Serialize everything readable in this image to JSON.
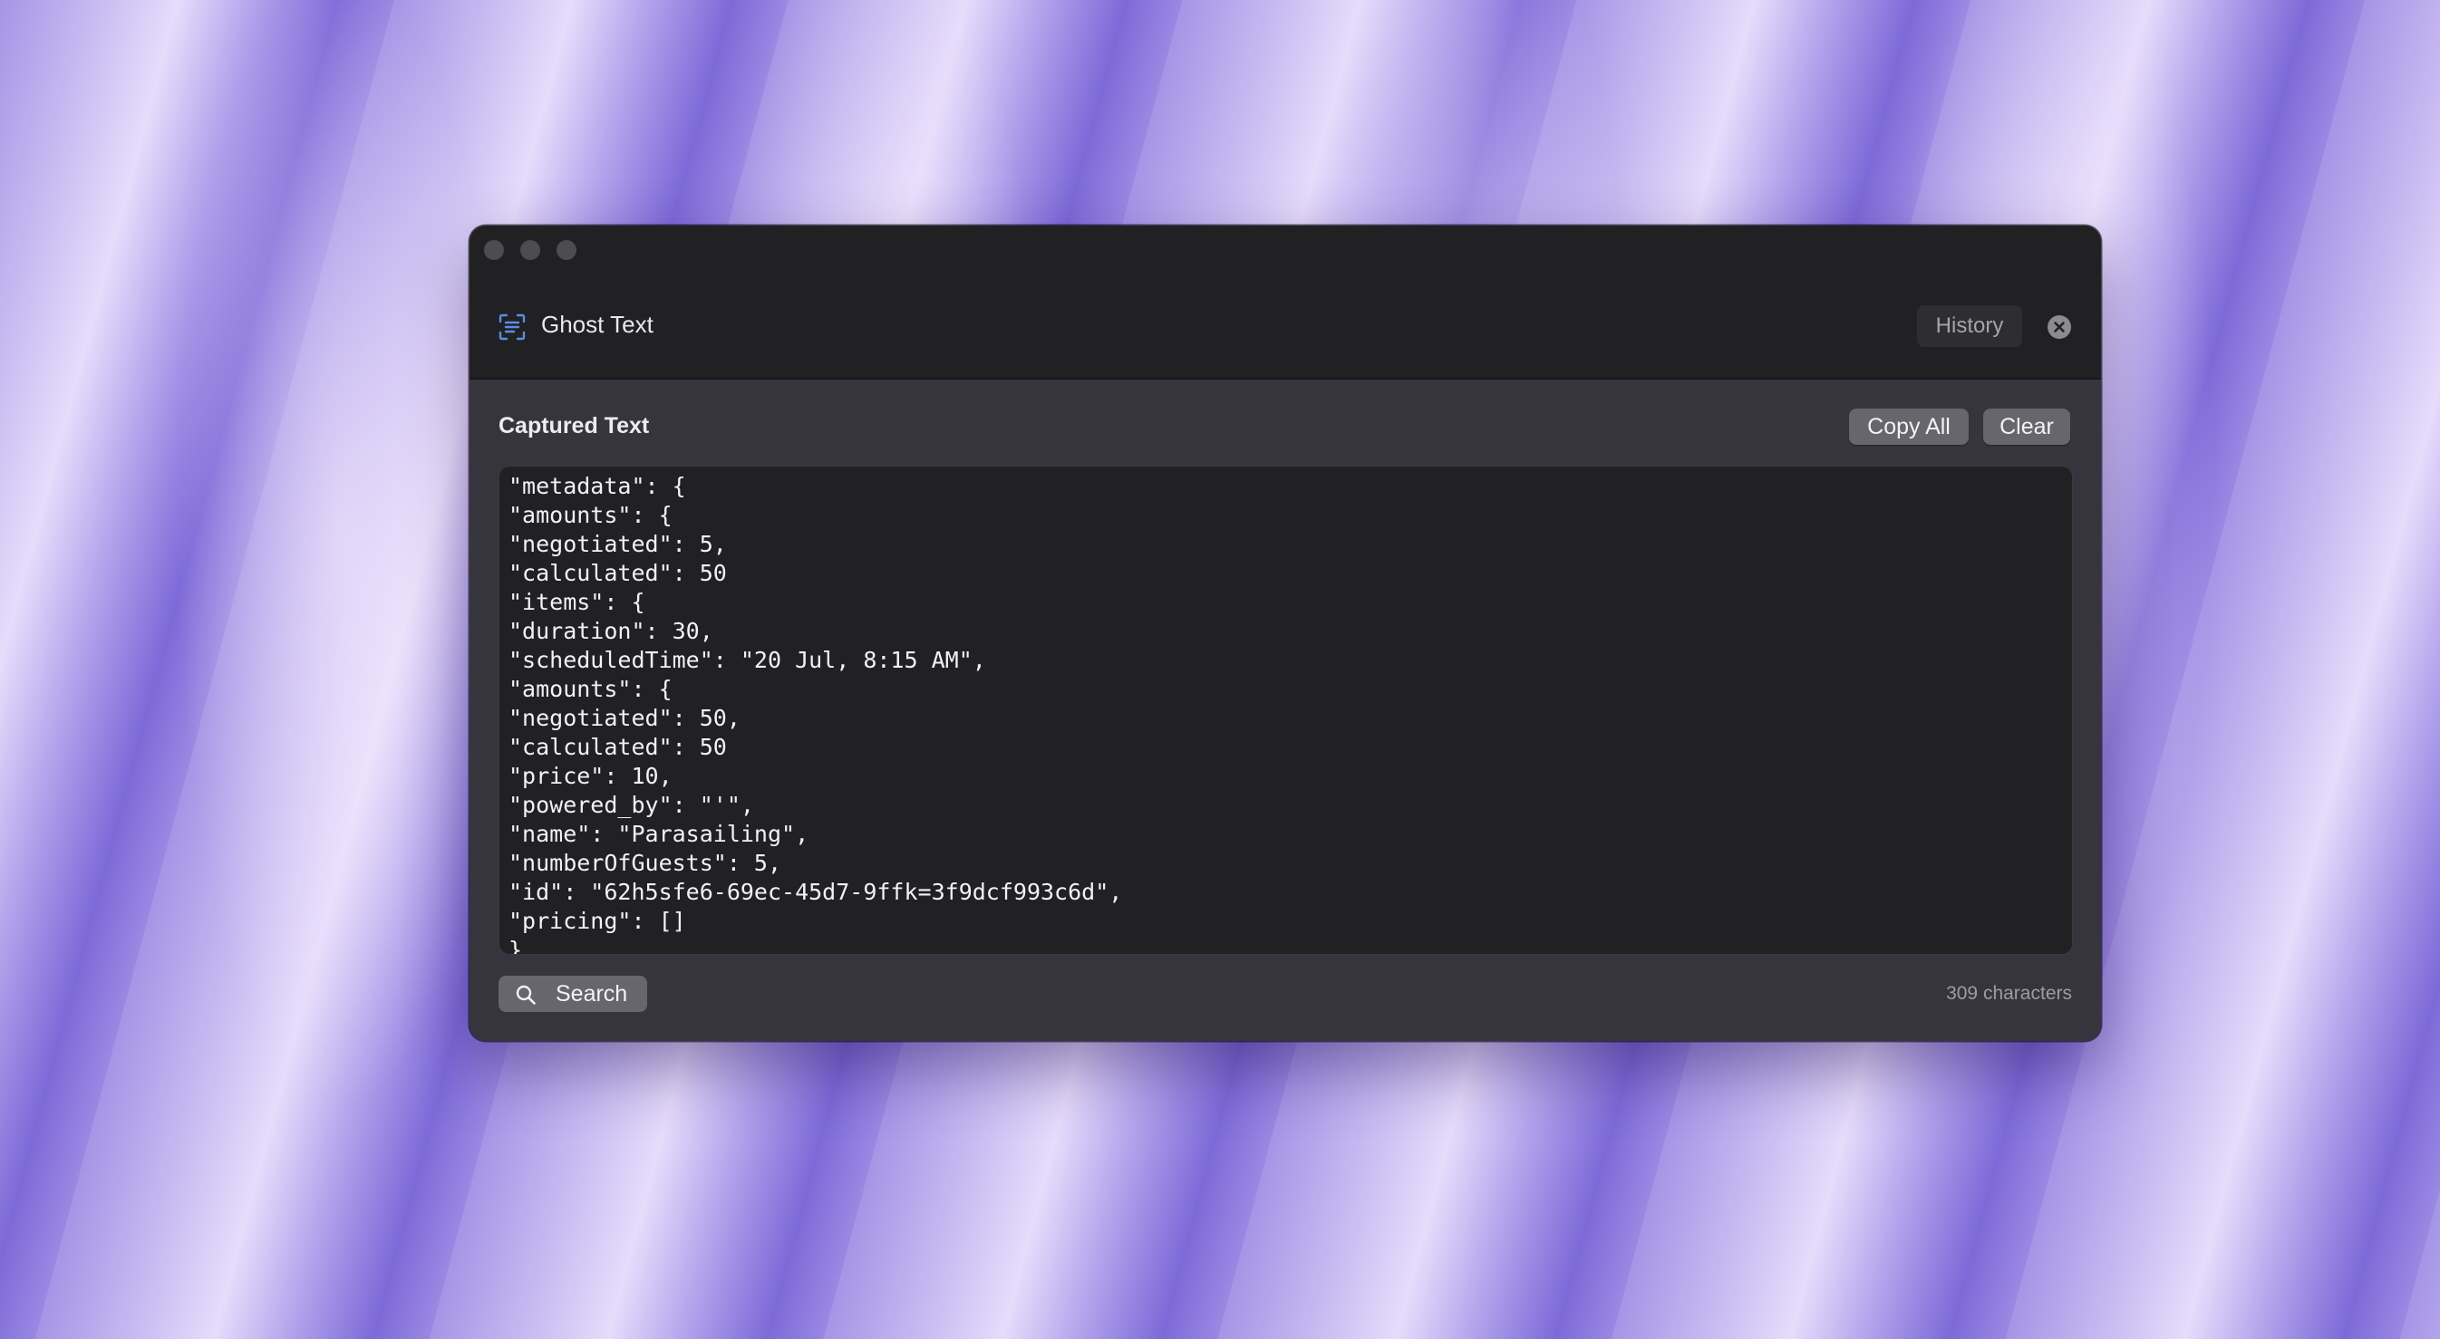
{
  "window": {
    "app_title": "Ghost Text",
    "history_label": "History",
    "close_icon": "close-circle-icon",
    "app_icon": "text-scan-icon"
  },
  "captured": {
    "title": "Captured Text",
    "copy_all_label": "Copy All",
    "clear_label": "Clear",
    "lines": [
      "\"metadata\": {",
      "\"amounts\": {",
      "\"negotiated\": 5,",
      "\"calculated\": 50",
      "\"items\": {",
      "\"duration\": 30,",
      "\"scheduledTime\": \"20 Jul, 8:15 AM\",",
      "\"amounts\": {",
      "\"negotiated\": 50,",
      "\"calculated\": 50",
      "\"price\": 10,",
      "\"powered_by\": \"'\",",
      "\"name\": \"Parasailing\",",
      "\"numberOfGuests\": 5,",
      "\"id\": \"62h5sfe6-69ec-45d7-9ffk=3f9dcf993c6d\",",
      "\"pricing\": []",
      "}"
    ]
  },
  "footer": {
    "search_label": "Search",
    "char_count": "309 characters"
  },
  "colors": {
    "window_bg": "#36353d",
    "titlebar_bg": "#212123",
    "text_area_bg": "#212123",
    "button_bg": "#66666c",
    "accent_icon": "#5b8de8"
  }
}
